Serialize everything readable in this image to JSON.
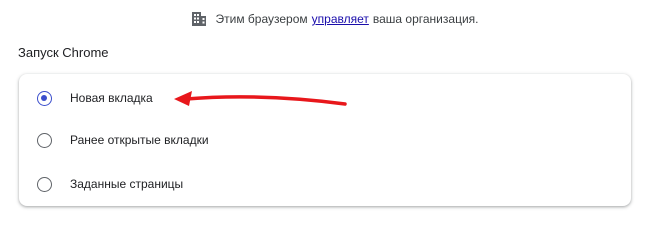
{
  "managed_banner": {
    "prefix": "Этим браузером",
    "link": "управляет",
    "suffix": "ваша организация.",
    "icon": "building-icon"
  },
  "startup": {
    "title": "Запуск Chrome",
    "options": [
      {
        "label": "Новая вкладка",
        "checked": true
      },
      {
        "label": "Ранее открытые вкладки",
        "checked": false
      },
      {
        "label": "Заданные страницы",
        "checked": false
      }
    ]
  },
  "colors": {
    "accent": "#3b4ecc",
    "annotation_arrow": "#e8171b",
    "link": "#1a0dab"
  }
}
